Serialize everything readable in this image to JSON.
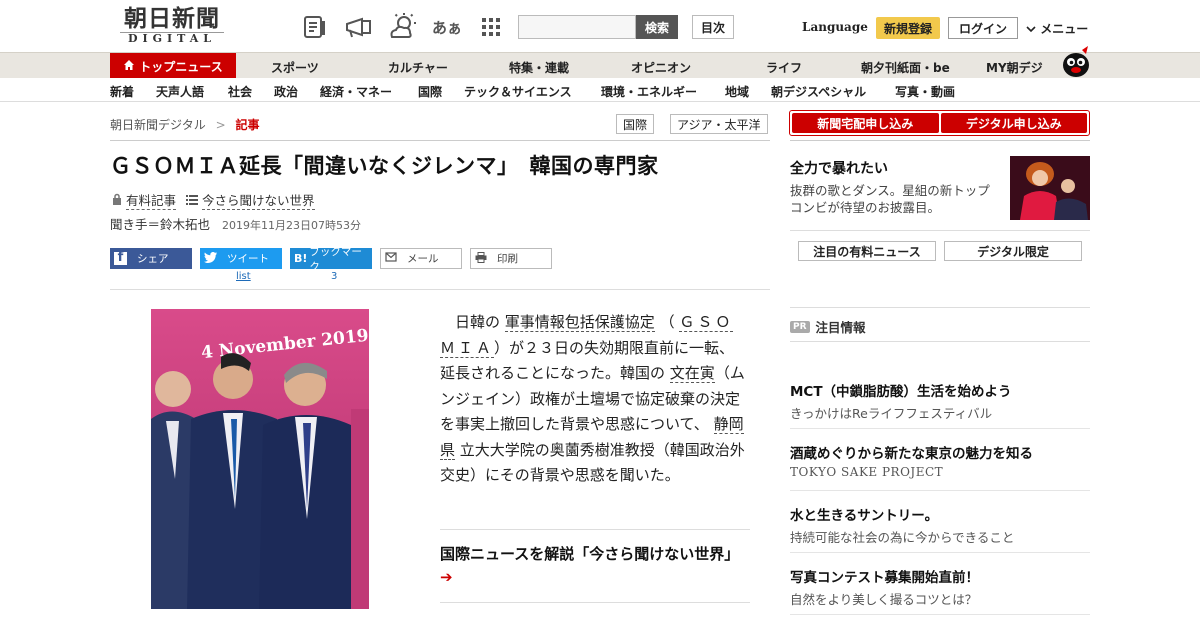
{
  "header": {
    "logo_main": "朝日新聞",
    "logo_sub": "DIGITAL",
    "search_button": "検索",
    "toc_button": "目次",
    "language": "Language",
    "register": "新規登録",
    "login": "ログイン",
    "menu": "メニュー",
    "icons": [
      "newspaper-icon",
      "megaphone-icon",
      "weather-icon",
      "font-size-icon",
      "grid-icon"
    ],
    "font_icon_text": "あぁ"
  },
  "nav1": {
    "top_news": "トップニュース",
    "items": [
      "スポーツ",
      "カルチャー",
      "特集・連載",
      "オピニオン",
      "ライフ",
      "朝夕刊紙面・be",
      "MY朝デジ"
    ]
  },
  "nav2": {
    "items": [
      "新着",
      "天声人語",
      "社会",
      "政治",
      "経済・マネー",
      "国際",
      "テック＆サイエンス",
      "環境・エネルギー",
      "地域",
      "朝デジスペシャル",
      "写真・動画"
    ]
  },
  "breadcrumb": {
    "home": "朝日新聞デジタル",
    "sep": ">",
    "current": "記事"
  },
  "tags": [
    "国際",
    "アジア・太平洋"
  ],
  "article": {
    "title": "ＧＳＯＭＩＡ延長「間違いなくジレンマ」　韓国の専門家",
    "paid_label": "有料記事",
    "series_label": "今さら聞けない世界",
    "author": "聞き手＝鈴木拓也",
    "date": "2019年11月23日07時53分",
    "body": {
      "p1": "日韓の",
      "link1": "軍事情報包括保護協定",
      "p2": "（",
      "link2": "ＧＳＯＭＩＡ",
      "p3": "）が２３日の失効期限直前に一転、延長されることになった。韓国の",
      "link3": "文在寅",
      "p4": "（ムンジェイン）政権が土壇場で協定破棄の決定を事実上撤回した背景や思惑について、",
      "link4": "静岡県",
      "p5": "立大大学院の奥薗秀樹准教授（韓国政治外交史）にその背景や思惑を聞いた。"
    },
    "related": "国際ニュースを解説「今さら聞けない世界」",
    "related_arrow": "➔",
    "photo_banner": "4 November 2019,"
  },
  "share": {
    "facebook": "シェア",
    "twitter": "ツイート",
    "twitter_count": "list",
    "hatena": "ブックマーク",
    "hatena_icon": "B!",
    "hatena_count": "3",
    "mail": "メール",
    "print": "印刷"
  },
  "sidebar": {
    "promo1": "新聞宅配申し込み",
    "promo2": "デジタル申し込み",
    "ad_title": "全力で暴れたい",
    "ad_text": "抜群の歌とダンス。星組の新トップコンビが待望のお披露目。",
    "tab1": "注目の有料ニュース",
    "tab2": "デジタル限定",
    "pr_badge": "PR",
    "pr_title": "注目情報",
    "pr_items": [
      {
        "title": "MCT（中鎖脂肪酸）生活を始めよう",
        "sub": "きっかけはReライフフェスティバル"
      },
      {
        "title": "酒蔵めぐりから新たな東京の魅力を知る",
        "sub": "TOKYO SAKE PROJECT"
      },
      {
        "title": "水と生きるサントリー。",
        "sub": "持続可能な社会の為に今からできること"
      },
      {
        "title": "写真コンテスト募集開始直前！",
        "sub": "自然をより美しく撮るコツとは？"
      }
    ]
  },
  "colors": {
    "brand_red": "#cc0000",
    "nav_bg": "#e9e6e0",
    "register_yellow": "#f2c94c",
    "facebook": "#3b5998",
    "twitter": "#1d9bf0",
    "hatena": "#1e8bd5"
  }
}
